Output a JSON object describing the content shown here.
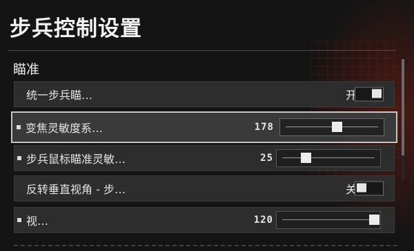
{
  "page": {
    "title": "步兵控制设置"
  },
  "section": {
    "title": "瞄准"
  },
  "settings": [
    {
      "label": "统一步兵瞄…",
      "type": "toggle",
      "state_label": "开",
      "on": true,
      "bullet": false,
      "active": false
    },
    {
      "label": "变焦灵敏度系…",
      "type": "slider",
      "value": "178",
      "fraction": 0.55,
      "bullet": true,
      "active": true
    },
    {
      "label": "步兵鼠标瞄准灵敏…",
      "type": "slider",
      "value": "25",
      "fraction": 0.25,
      "bullet": true,
      "active": false
    },
    {
      "label": "反转垂直视角 - 步…",
      "type": "toggle",
      "state_label": "关",
      "on": false,
      "bullet": false,
      "active": false
    },
    {
      "label": "视…",
      "type": "slider",
      "value": "120",
      "fraction": 1.0,
      "bullet": true,
      "active": false
    }
  ],
  "scrollbar": {
    "position": 0.0
  },
  "colors": {
    "background": "#141414",
    "row": "#2d2d2d",
    "row_active": "#3a3a3a",
    "highlight_border": "#c7c7c7",
    "accent_bg": "#781e14"
  }
}
